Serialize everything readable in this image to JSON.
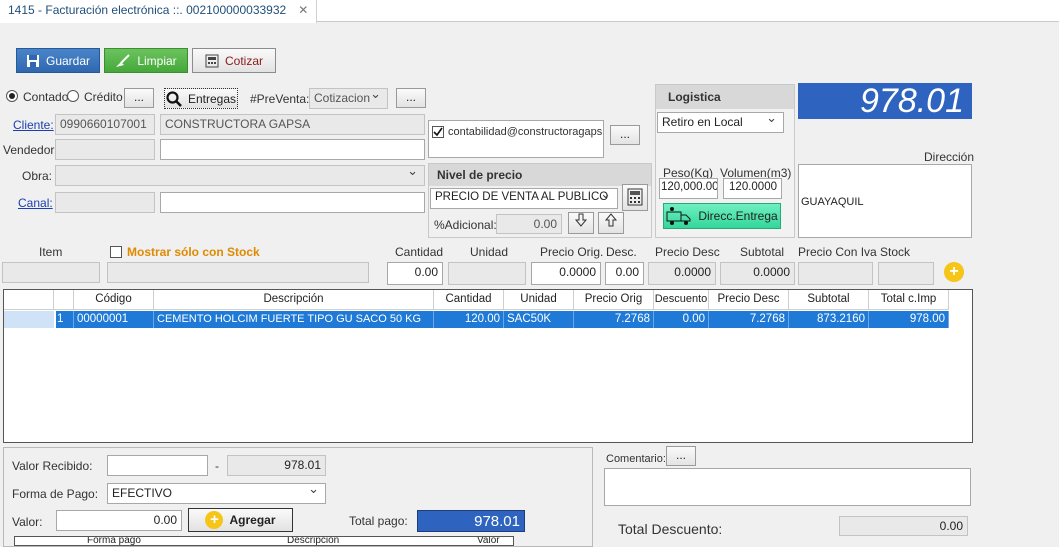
{
  "tab": {
    "title": "1415 - Facturación electrónica ::. 002100000033932",
    "close": "✕"
  },
  "toolbar": {
    "save": "Guardar",
    "clear": "Limpiar",
    "quote": "Cotizar"
  },
  "payment_type": {
    "contado": "Contado",
    "credito": "Crédito",
    "selected": "Contado",
    "dots": "..."
  },
  "entregas": "Entregas",
  "preventa": {
    "label": "#PreVenta:",
    "value": "Cotizacion",
    "dots": "..."
  },
  "cliente": {
    "label": "Cliente:",
    "id": "0990660107001",
    "name": "CONSTRUCTORA GAPSA"
  },
  "vendedor": {
    "label": "Vendedor:"
  },
  "obra": {
    "label": "Obra:"
  },
  "canal": {
    "label": "Canal:"
  },
  "email": {
    "value": "contabilidad@constructoragapsa",
    "checked": true,
    "dots": "..."
  },
  "nivel_precio": {
    "title": "Nivel de precio",
    "value": "PRECIO DE VENTA AL PUBLICO",
    "adicional_label": "%Adicional:",
    "adicional_value": "0.00"
  },
  "logistica": {
    "title": "Logistica",
    "option": "Retiro en Local",
    "peso_label": "Peso(Kg)",
    "peso_value": "120,000.00",
    "volumen_label": "Volumen(m3)",
    "volumen_value": "120.0000",
    "direcc_button": "Direcc.Entrega"
  },
  "total_display": "978.01",
  "direccion": {
    "label": "Dirección",
    "value": "GUAYAQUIL"
  },
  "entry": {
    "item_label": "Item",
    "stock_only_label": "Mostrar sólo con Stock",
    "cantidad_label": "Cantidad",
    "cantidad": "0.00",
    "unidad_label": "Unidad",
    "precio_orig_label": "Precio Orig.",
    "precio_orig": "0.0000",
    "desc_label": "Desc.",
    "desc": "0.00",
    "precio_desc_label": "Precio Desc",
    "precio_desc": "0.0000",
    "subtotal_label": "Subtotal",
    "subtotal": "0.0000",
    "precio_iva_label": "Precio Con Iva",
    "stock_label": "Stock",
    "add": "+"
  },
  "grid": {
    "columns": [
      "Código",
      "Descripción",
      "Cantidad",
      "Unidad",
      "Precio Orig",
      "Descuento",
      "Precio Desc",
      "Subtotal",
      "Total c.Imp"
    ],
    "rows": [
      {
        "n": "1",
        "codigo": "00000001",
        "descripcion": "CEMENTO HOLCIM FUERTE TIPO GU SACO 50 KG",
        "cantidad": "120.00",
        "unidad": "SAC50K",
        "precio_orig": "7.2768",
        "descuento": "0.00",
        "precio_desc": "7.2768",
        "subtotal": "873.2160",
        "total": "978.00"
      }
    ]
  },
  "pago": {
    "recibido_label": "Valor Recibido:",
    "dash": "-",
    "recibido_total": "978.01",
    "forma_label": "Forma de Pago:",
    "forma_value": "EFECTIVO",
    "valor_label": "Valor:",
    "valor": "0.00",
    "agregar": "Agregar",
    "total_pago_label": "Total pago:",
    "total_pago": "978.01",
    "table_cols": [
      "Forma pago",
      "Descripción",
      "Valor"
    ]
  },
  "comentario": {
    "label": "Comentario:",
    "dots": "..."
  },
  "totales": {
    "descuento_label": "Total Descuento:",
    "descuento": "0.00"
  },
  "colors": {
    "accent": "#2e64c0",
    "selection": "#1e7ad6",
    "green": "#45a83a"
  }
}
